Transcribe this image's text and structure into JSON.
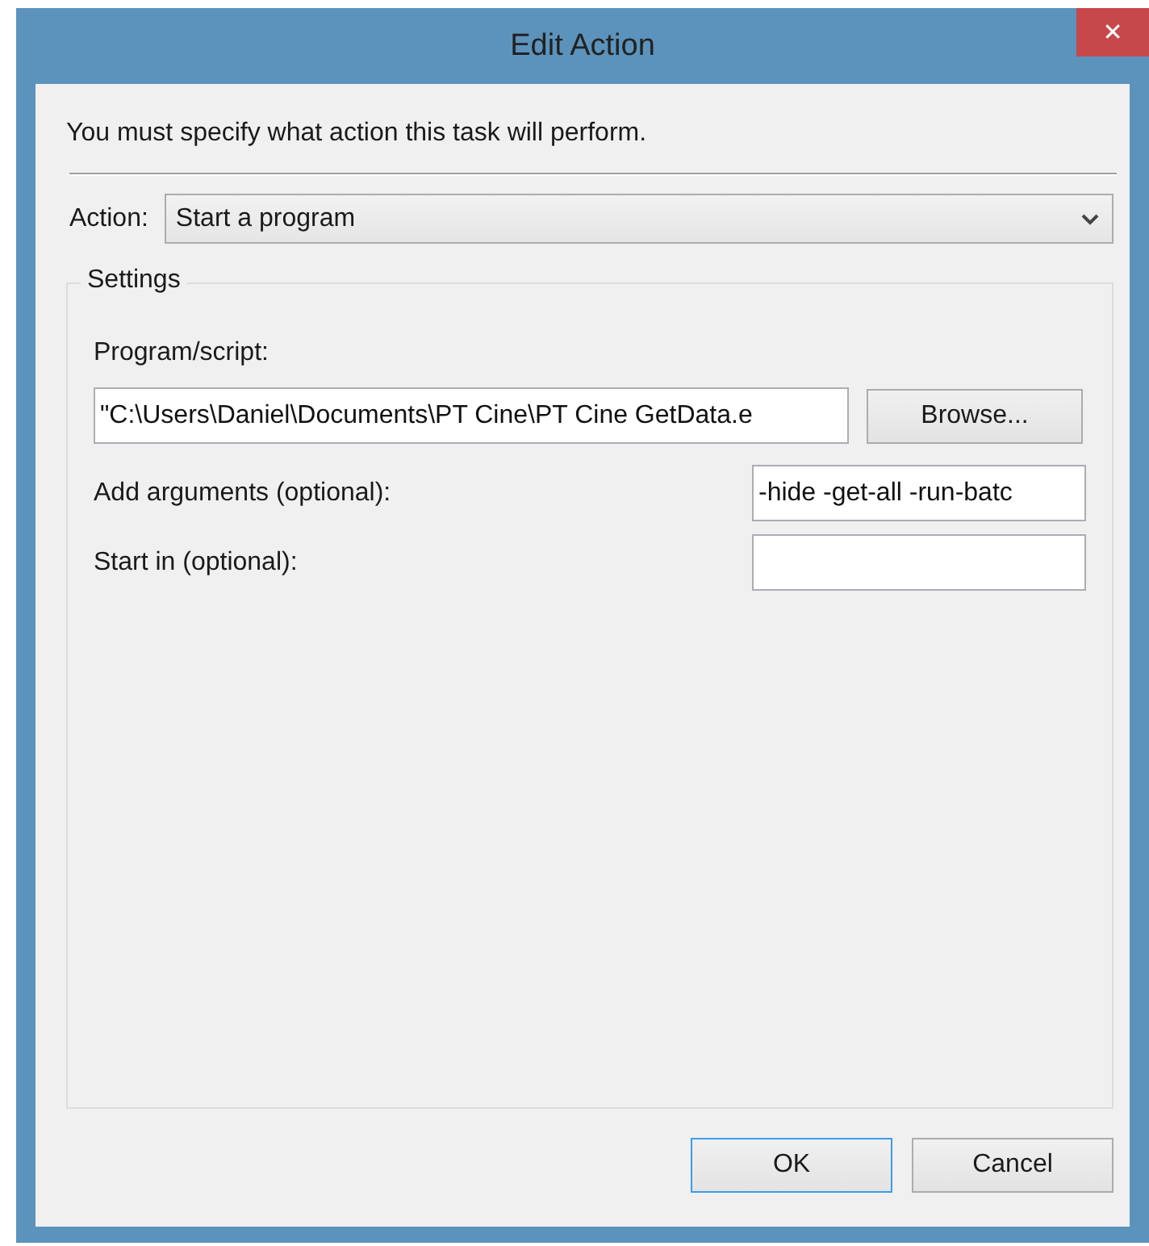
{
  "window": {
    "title": "Edit Action",
    "close": "✕"
  },
  "instruction": "You must specify what action this task will perform.",
  "action": {
    "label": "Action:",
    "value": "Start a program"
  },
  "settings": {
    "title": "Settings",
    "program": {
      "label": "Program/script:",
      "value": "\"C:\\Users\\Daniel\\Documents\\PT Cine\\PT Cine GetData.e",
      "button": "Browse..."
    },
    "fields": [
      {
        "label": "Add arguments (optional):",
        "value": "-hide -get-all -run-batc"
      },
      {
        "label": "Start in (optional):"
      }
    ]
  },
  "buttons": [
    {
      "label": "OK",
      "default": true
    },
    {
      "label": "Cancel",
      "default": false
    }
  ]
}
